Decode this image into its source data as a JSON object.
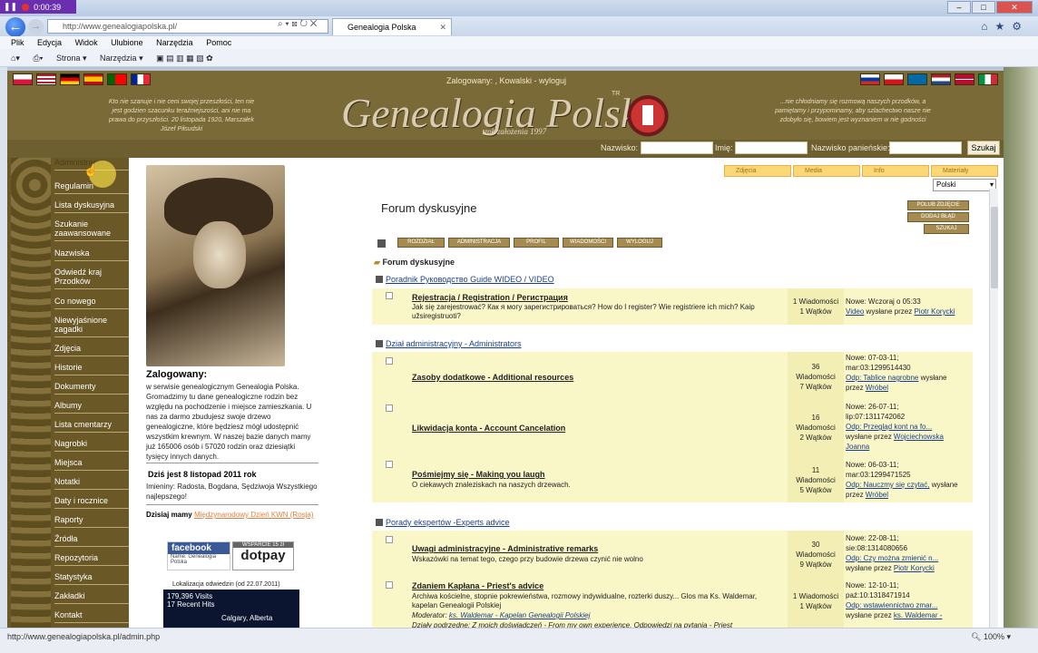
{
  "recorder": {
    "time": "0:00:39"
  },
  "browser": {
    "url": "http://www.genealogiapolska.pl/",
    "tab_title": "Genealogia Polska",
    "menu": [
      "Plik",
      "Edycja",
      "Widok",
      "Ulubione",
      "Narzędzia",
      "Pomoc"
    ],
    "cmd": [
      "Strona ▾",
      "Narzędzia ▾"
    ],
    "status_url": "http://www.genealogiapolska.pl/admin.php",
    "zoom": "100%"
  },
  "header": {
    "logged_in": "Zalogowany: , Kowalski  -  wyloguj",
    "logo": "Genealogia Polska",
    "logo_tm": "TR",
    "logo_sub": "rok założenia 1997",
    "quote_left": "Kto nie szanuje i nie ceni swojej przeszłości, ten nie jest godzien szacunku teraźniejszości, ani nie ma prawa do przyszłości. 20 listopada 1920, Marszałek Józef Piłsudski",
    "quote_right": "...nie chłodniamy się rozmową naszych przodków, a pamiętamy i przypominamy, aby szlachectwo nasze nie zdobyło się, bowiem jest wyznaniem w nie godności"
  },
  "search": {
    "surname_label": "Nazwisko:",
    "name_label": "Imię:",
    "maiden_label": "Nazwisko panieńskie:",
    "button": "Szukaj"
  },
  "sidebar": {
    "items": [
      "Administracja",
      "Regulamin",
      "Lista dyskusyjna",
      "Szukanie zaawansowane",
      "Nazwiska",
      "Odwiedź kraj Przodków",
      "Co nowego",
      "Niewyjaśnione zagadki",
      "Zdjęcia",
      "Historie",
      "Dokumenty",
      "Albumy",
      "Lista cmentarzy",
      "Nagrobki",
      "Miejsca",
      "Notatki",
      "Daty i rocznice",
      "Raporty",
      "Źródła",
      "Repozytoria",
      "Statystyka",
      "Zakładki",
      "Kontakt"
    ]
  },
  "left": {
    "logged_heading": "Zalogowany:",
    "logged_body": "w serwisie genealogicznym Genealogia Polska. Gromadzimy tu dane genealogiczne rodzin bez względu na pochodzenie i miejsce zamieszkania. U nas za darmo zbudujesz swoje drzewo genealogiczne, które będziesz mógł udostępnić wszystkim krewnym. W naszej bazie danych mamy już 165006 osób i 57020 rodzin oraz dziesiątki tysięcy innych danych.",
    "date": "Dziś jest 8 listopad 2011 rok",
    "names": "Imieniny: Radosta, Bogdana, Sędziwoja Wszystkiego najlepszego!",
    "dzisiaj": "Dzisiaj mamy",
    "dzisiaj_link": "Międzynarodowy Dzień KWN (Rosja)",
    "fb": "facebook",
    "fb_name": "Name: Genealogia Polska",
    "dotpay_top": "WSPARCIE 15 zł",
    "dotpay": "dotpay",
    "lokal": "Lokalizacja odwiedzin (od 22.07.2011)",
    "map_line1": "179,396 Visits",
    "map_line2": "17 Recent Hits",
    "map_line3": "Calgary, Alberta"
  },
  "widgets": {
    "tabs": [
      "Zdjęcia",
      "Media",
      "Info",
      "Materiały"
    ],
    "lang": "Polski",
    "btn1": "POLUB ZDJĘCIE",
    "btn2": "DODAJ BŁĄD",
    "btn3": "SZUKAJ"
  },
  "forum": {
    "title": "Forum dyskusyjne",
    "toolbar": [
      "ROZDZIAŁ",
      "ADMINISTRACJA",
      "PROFIL",
      "WIADOMOŚCI",
      "WYLOGUJ"
    ],
    "root": "Forum dyskusyjne",
    "sections": [
      "Poradnik Руководство Guide WIDEO / VIDEO",
      "Dział administracyjny - Administrators",
      "Porady ekspertów -Experts advice"
    ],
    "topics": [
      {
        "title": "Rejestracja / Registration / Регистрация",
        "desc": "Jak się zarejestrować? Как я могу зарегистрироваться? How do I register? Wie registriere ich mich? Kaip užsiregistruoti?",
        "stat1": "1 Wiadomości",
        "stat2": "1 Wątków",
        "last1": "Nowe: Wczoraj o 05:33",
        "last2a": "Video",
        "last2b": " wysłane przez ",
        "last2c": "Piotr Korycki"
      },
      {
        "title": "Zasoby dodatkowe - Additional resources",
        "stat0": "36",
        "stat1": "Wiadomości",
        "stat2": "7 Wątków",
        "last1": "Nowe: 07-03-11;",
        "last2": "mar:03:1299514430",
        "last3a": "Odp: Tablice nagrobne",
        "last3b": " wysłane",
        "last4a": "przez ",
        "last4b": "Wróbel"
      },
      {
        "title": "Likwidacja konta - Account Cancelation",
        "stat0": "16",
        "stat1": "Wiadomości",
        "stat2": "2 Wątków",
        "last1": "Nowe: 26-07-11;",
        "last2": "lip:07:1311742062",
        "last3a": "Odp: Przegląd kont na fo...",
        "last4a": "wysłane przez ",
        "last4b": "Wojciechowska",
        "last5": "Joanna"
      },
      {
        "title": "Pośmiejmy się - Making you laugh",
        "desc": "O ciekawych znaleziskach na naszych drzewach.",
        "stat0": "11",
        "stat1": "Wiadomości",
        "stat2": "5 Wątków",
        "last1": "Nowe: 06-03-11;",
        "last2": "mar:03:1299471525",
        "last3a": "Odp: Nauczmy się czytać,",
        "last3b": " wysłane",
        "last4a": "przez ",
        "last4b": "Wróbel"
      },
      {
        "title": "Uwagi administracyjne - Administrative remarks",
        "desc": "Wskazówki na temat tego, czego przy budowie drzewa czynić nie wolno",
        "stat0": "30",
        "stat1": "Wiadomości",
        "stat2": "9 Wątków",
        "last1": "Nowe: 22-08-11;",
        "last2": "sie:08:1314080656",
        "last3a": "Odp: Czy można zmienić n...",
        "last4a": "wysłane przez ",
        "last4b": "Piotr Korycki"
      },
      {
        "title": "Zdaniem Kapłana - Priest's advice",
        "desc": "Archiwa kościelne, stopnie pokrewieństwa, rozmowy indywidualne, rozterki duszy... Glos ma Ks. Waldemar, kapelan Genealogii Polskiej",
        "mod_label": "Moderator: ",
        "mod": "ks. Waldemar - Kapelan Genealogii Polskiej",
        "sub": "Działy podrzędne: Z moich doświadczeń - From my own experience, Odpowiedzi na pytania - Priest",
        "stat1": "1 Wiadomości",
        "stat2": "1 Wątków",
        "last1": "Nowe: 12-10-11;",
        "last2": "paź:10:1318471914",
        "last3a": "Odp: wstawiennictwo zmar...",
        "last4a": "wysłane przez ",
        "last4b": "ks. Waldemar -"
      }
    ]
  },
  "colors": {
    "header": "#7a6a38",
    "row": "#f9f6c8",
    "accent": "#1c56c4"
  }
}
